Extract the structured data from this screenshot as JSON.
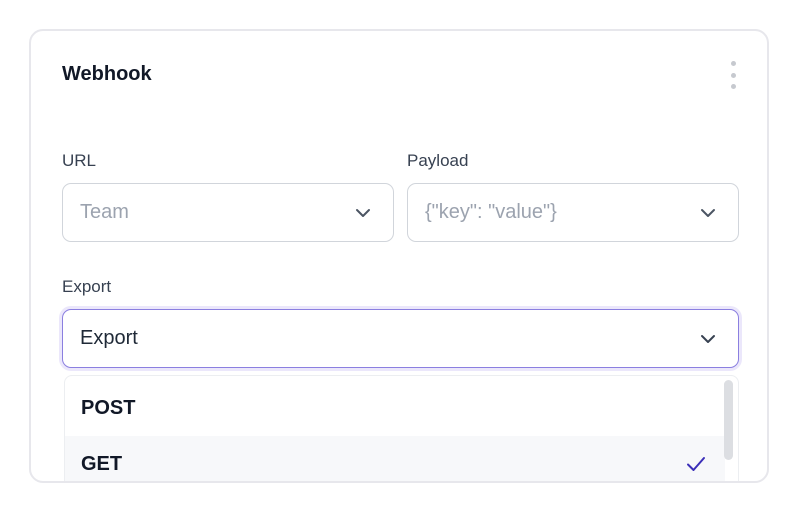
{
  "card": {
    "title": "Webhook"
  },
  "fields": {
    "url": {
      "label": "URL",
      "value": "Team"
    },
    "payload": {
      "label": "Payload",
      "value": "{\"key\": \"value\"}"
    },
    "export": {
      "label": "Export",
      "value": "Export"
    }
  },
  "dropdown": {
    "options": [
      {
        "label": "POST",
        "selected": false
      },
      {
        "label": "GET",
        "selected": true
      }
    ]
  },
  "colors": {
    "accent": "#8b7fe0",
    "check": "#3b2fb8",
    "border": "#d1d5db"
  },
  "icons": [
    "kebab-menu-icon",
    "chevron-down-icon",
    "check-icon"
  ]
}
